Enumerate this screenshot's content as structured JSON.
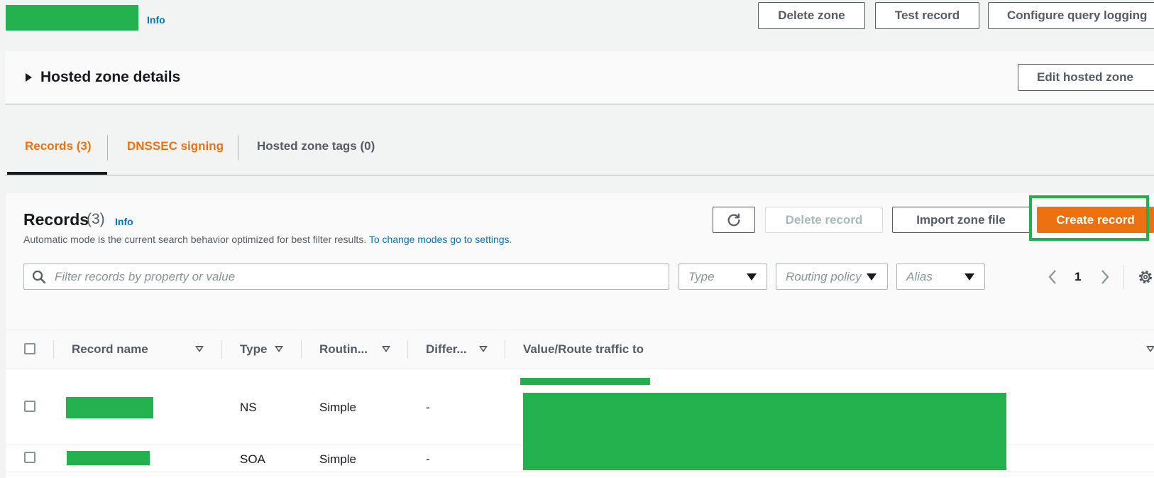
{
  "header": {
    "info_label": "Info",
    "buttons": {
      "delete_zone": "Delete zone",
      "test_record": "Test record",
      "configure_query_logging": "Configure query logging"
    }
  },
  "hosted_zone_details": {
    "title": "Hosted zone details",
    "edit_button": "Edit hosted zone"
  },
  "tabs": [
    {
      "label": "Records (3)",
      "active": true
    },
    {
      "label": "DNSSEC signing",
      "active": false
    },
    {
      "label": "Hosted zone tags (0)",
      "active": false
    }
  ],
  "records_panel": {
    "title": "Records",
    "count": "(3)",
    "info_label": "Info",
    "description": "Automatic mode is the current search behavior optimized for best filter results.",
    "settings_link": "To change modes go to settings.",
    "buttons": {
      "delete_record": "Delete record",
      "import_zone_file": "Import zone file",
      "create_record": "Create record"
    },
    "filters": {
      "search_placeholder": "Filter records by property or value",
      "type": "Type",
      "routing_policy": "Routing policy",
      "alias": "Alias"
    },
    "pagination": {
      "current_page": "1"
    }
  },
  "table": {
    "columns": [
      "Record name",
      "Type",
      "Routin...",
      "Differ...",
      "Value/Route traffic to"
    ],
    "rows": [
      {
        "type": "NS",
        "routing": "Simple",
        "differentiator": "-"
      },
      {
        "type": "SOA",
        "routing": "Simple",
        "differentiator": "-"
      }
    ]
  },
  "colors": {
    "accent_orange": "#ec7211",
    "link_blue": "#0073bb",
    "redaction_green": "#22b14c",
    "highlight_green": "#1fb14a"
  },
  "icons": [
    "refresh-icon",
    "search-icon",
    "chevron-left-icon",
    "chevron-right-icon",
    "gear-icon",
    "caret-right-icon"
  ]
}
